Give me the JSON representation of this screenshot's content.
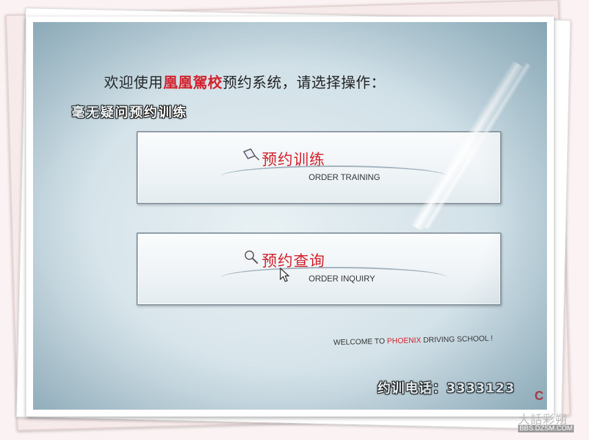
{
  "welcome": {
    "prefix": "欢迎使用",
    "brand": "凰凰駕校",
    "suffix": "预约系统，请选择操作："
  },
  "captions": {
    "top": "毫无疑问预约训练",
    "phone_label": "约训电话：",
    "phone_number": "3333123"
  },
  "buttons": {
    "order": {
      "cn": "预约训练",
      "en": "ORDER TRAINING"
    },
    "inquiry": {
      "cn": "预约查询",
      "en": "ORDER INQUIRY"
    }
  },
  "footer": {
    "pre": "WELCOME TO ",
    "brand": "PHOENIX",
    "post": " DRIVING SCHOOL !"
  },
  "logo_fragment": "C",
  "watermark": {
    "text": "大話彩朔",
    "url": "BBS.DZSM.COM"
  },
  "colors": {
    "accent_red": "#d4202a",
    "screen_blue": "#d2e1e8"
  }
}
